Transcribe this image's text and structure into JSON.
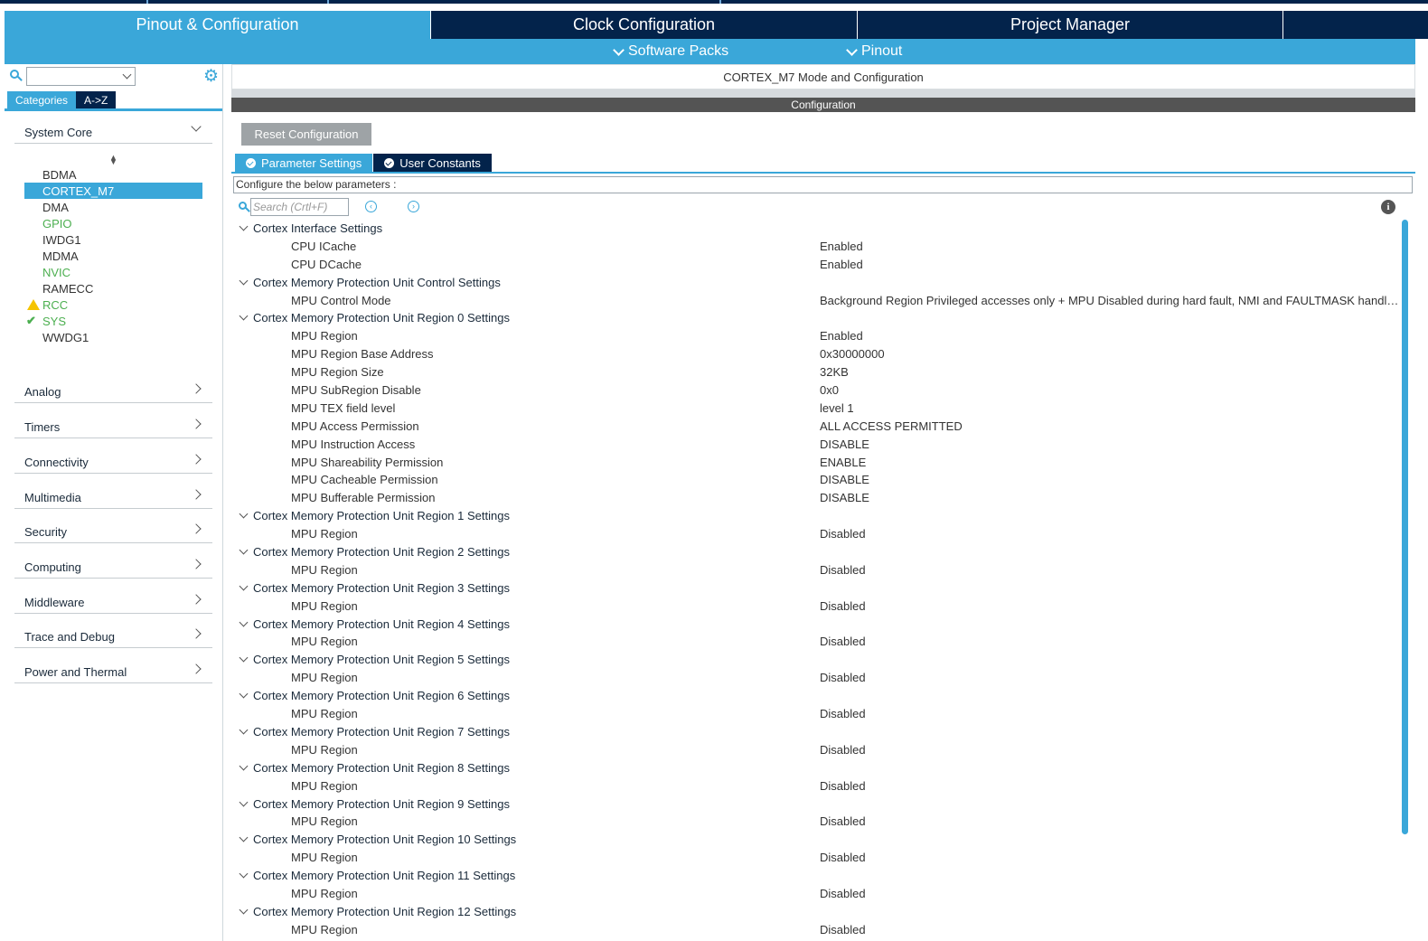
{
  "tabs": [
    {
      "label": "Pinout & Configuration",
      "active": true
    },
    {
      "label": "Clock Configuration",
      "active": false
    },
    {
      "label": "Project Manager",
      "active": false
    },
    {
      "label": "",
      "active": false
    }
  ],
  "subbar": {
    "software_packs": "Software Packs",
    "pinout": "Pinout"
  },
  "sidebar": {
    "category_tabs": [
      "Categories",
      "A->Z"
    ],
    "system_core": {
      "label": "System Core",
      "items": [
        {
          "label": "BDMA",
          "state": "normal"
        },
        {
          "label": "CORTEX_M7",
          "state": "selected"
        },
        {
          "label": "DMA",
          "state": "normal"
        },
        {
          "label": "GPIO",
          "state": "green"
        },
        {
          "label": "IWDG1",
          "state": "normal"
        },
        {
          "label": "MDMA",
          "state": "normal"
        },
        {
          "label": "NVIC",
          "state": "green"
        },
        {
          "label": "RAMECC",
          "state": "normal"
        },
        {
          "label": "RCC",
          "state": "warning"
        },
        {
          "label": "SYS",
          "state": "ok"
        },
        {
          "label": "WWDG1",
          "state": "normal"
        }
      ]
    },
    "categories": [
      "Analog",
      "Timers",
      "Connectivity",
      "Multimedia",
      "Security",
      "Computing",
      "Middleware",
      "Trace and Debug",
      "Power and Thermal"
    ]
  },
  "main": {
    "mode_header": "CORTEX_M7 Mode and Configuration",
    "config_header": "Configuration",
    "reset_button": "Reset Configuration",
    "param_tabs": [
      "Parameter Settings",
      "User Constants"
    ],
    "configure_label": "Configure the below parameters :",
    "search_placeholder": "Search (Crtl+F)",
    "rows": [
      {
        "type": "group",
        "label": "Cortex Interface Settings"
      },
      {
        "type": "param",
        "label": "CPU ICache",
        "value": "Enabled"
      },
      {
        "type": "param",
        "label": "CPU DCache",
        "value": "Enabled"
      },
      {
        "type": "group",
        "label": "Cortex Memory Protection Unit Control Settings"
      },
      {
        "type": "param",
        "label": "MPU Control Mode",
        "value": "Background Region Privileged accesses only + MPU Disabled during hard fault, NMI and FAULTMASK handlers"
      },
      {
        "type": "group",
        "label": "Cortex Memory Protection Unit Region 0 Settings"
      },
      {
        "type": "param",
        "label": "MPU Region",
        "value": "Enabled"
      },
      {
        "type": "param",
        "label": "MPU Region Base Address",
        "value": "0x30000000"
      },
      {
        "type": "param",
        "label": "MPU Region Size",
        "value": "32KB"
      },
      {
        "type": "param",
        "label": "MPU SubRegion Disable",
        "value": "0x0"
      },
      {
        "type": "param",
        "label": "MPU TEX field level",
        "value": "level 1"
      },
      {
        "type": "param",
        "label": "MPU Access Permission",
        "value": "ALL ACCESS PERMITTED"
      },
      {
        "type": "param",
        "label": "MPU Instruction Access",
        "value": "DISABLE"
      },
      {
        "type": "param",
        "label": "MPU Shareability Permission",
        "value": "ENABLE"
      },
      {
        "type": "param",
        "label": "MPU Cacheable Permission",
        "value": "DISABLE"
      },
      {
        "type": "param",
        "label": "MPU Bufferable  Permission",
        "value": "DISABLE"
      },
      {
        "type": "group",
        "label": "Cortex Memory Protection Unit Region 1 Settings"
      },
      {
        "type": "param",
        "label": "MPU Region",
        "value": "Disabled"
      },
      {
        "type": "group",
        "label": "Cortex Memory Protection Unit Region 2 Settings"
      },
      {
        "type": "param",
        "label": "MPU Region",
        "value": "Disabled"
      },
      {
        "type": "group",
        "label": "Cortex Memory Protection Unit Region 3 Settings"
      },
      {
        "type": "param",
        "label": "MPU Region",
        "value": "Disabled"
      },
      {
        "type": "group",
        "label": "Cortex Memory Protection Unit Region 4 Settings"
      },
      {
        "type": "param",
        "label": "MPU Region",
        "value": "Disabled"
      },
      {
        "type": "group",
        "label": "Cortex Memory Protection Unit Region 5 Settings"
      },
      {
        "type": "param",
        "label": "MPU Region",
        "value": "Disabled"
      },
      {
        "type": "group",
        "label": "Cortex Memory Protection Unit Region 6 Settings"
      },
      {
        "type": "param",
        "label": "MPU Region",
        "value": "Disabled"
      },
      {
        "type": "group",
        "label": "Cortex Memory Protection Unit Region 7 Settings"
      },
      {
        "type": "param",
        "label": "MPU Region",
        "value": "Disabled"
      },
      {
        "type": "group",
        "label": "Cortex Memory Protection Unit Region 8 Settings"
      },
      {
        "type": "param",
        "label": "MPU Region",
        "value": "Disabled"
      },
      {
        "type": "group",
        "label": "Cortex Memory Protection Unit Region 9 Settings"
      },
      {
        "type": "param",
        "label": "MPU Region",
        "value": "Disabled"
      },
      {
        "type": "group",
        "label": "Cortex Memory Protection Unit Region 10 Settings"
      },
      {
        "type": "param",
        "label": "MPU Region",
        "value": "Disabled"
      },
      {
        "type": "group",
        "label": "Cortex Memory Protection Unit Region 11 Settings"
      },
      {
        "type": "param",
        "label": "MPU Region",
        "value": "Disabled"
      },
      {
        "type": "group",
        "label": "Cortex Memory Protection Unit Region 12 Settings"
      },
      {
        "type": "param",
        "label": "MPU Region",
        "value": "Disabled"
      }
    ]
  },
  "colors": {
    "accent": "#3aa7d9",
    "navy": "#03234b",
    "green_status": "#4caf50",
    "warning": "#f5c400"
  },
  "icons": [
    "search-icon",
    "gear-icon",
    "chevron-down-icon",
    "chevron-right-icon",
    "warning-icon",
    "check-icon",
    "info-icon",
    "previous-icon",
    "next-icon"
  ]
}
